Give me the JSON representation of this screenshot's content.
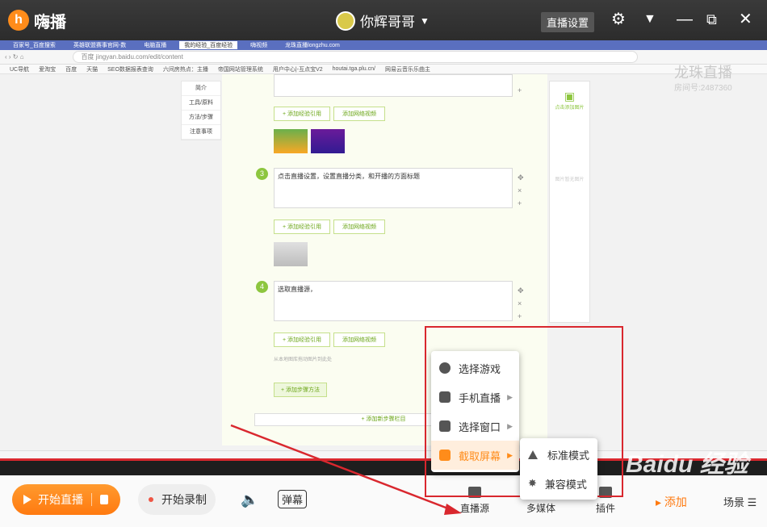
{
  "app": {
    "logo_text": "嗨播",
    "user_name": "你辉哥哥",
    "live_settings_label": "直播设置"
  },
  "browser": {
    "tabs": [
      "百家号_百度搜索",
      "英雄联盟赛事官网-数",
      "电脑直播",
      "我的经验_百度经验",
      "嗨视频",
      "龙珠直播longzhu.com"
    ],
    "url_prefix": "百度",
    "url": "jingyan.baidu.com/edit/content",
    "bookmarks": [
      "UC导航",
      "爱淘宝",
      "百度",
      "天猫",
      "SEO数据报表查询",
      "六间房热点：主播",
      "帝国网站管理系统",
      "用户中心|-互点宝V2",
      "houtai.tga.plu.cn/",
      "网易云音乐乐曲主"
    ]
  },
  "editor": {
    "left_menu": [
      "简介",
      "工具/原料",
      "方法/步骤",
      "注意事项"
    ],
    "add_exp_ref": "+ 添加经验引用",
    "add_web_video": "添加网络视频",
    "steps": [
      {
        "num": "3",
        "text": "点击直播设置，设置直播分类，和开播的方面标题"
      },
      {
        "num": "4",
        "text": "选取直播源，"
      }
    ],
    "add_step": "+ 添加步骤方法",
    "add_section": "+ 添加新步骤栏目",
    "right_panel_label": "点击添加图片",
    "right_panel_note": "图片暂无图片",
    "hint": "从本地图库拖动图片到此处"
  },
  "menu": {
    "items": [
      {
        "label": "选择游戏",
        "icon": "pacman-icon"
      },
      {
        "label": "手机直播",
        "icon": "phone-icon"
      },
      {
        "label": "选择窗口",
        "icon": "window-icon"
      },
      {
        "label": "截取屏幕",
        "icon": "crop-icon"
      }
    ],
    "sub_items": [
      {
        "label": "标准模式",
        "icon": "triangle-icon"
      },
      {
        "label": "兼容模式",
        "icon": "star-icon"
      }
    ]
  },
  "bottom": {
    "start_live": "开始直播",
    "start_record": "开始录制",
    "danmu": "弹幕",
    "tools": [
      "直播源",
      "多媒体",
      "插件"
    ],
    "add": "添加",
    "scene": "场景"
  },
  "watermarks": {
    "top_right_line1": "龙珠直播",
    "top_right_line2": "房间号:2487360",
    "baidu": "Baidu 经验"
  },
  "colors": {
    "accent": "#ff8c1a",
    "highlight_red": "#d9272e",
    "green": "#8dc63f"
  }
}
